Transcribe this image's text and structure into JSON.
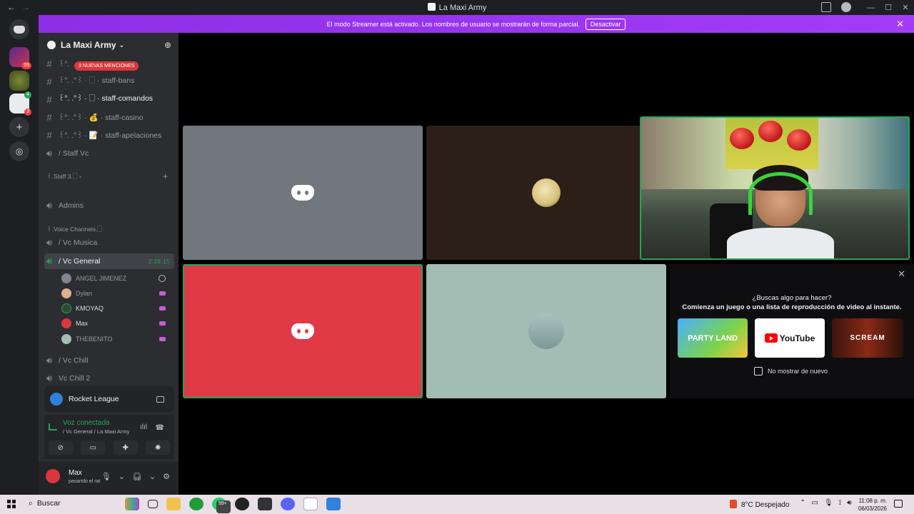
{
  "window": {
    "title": "La Maxi Army"
  },
  "streamer_banner": {
    "text": "El modo Streamer está activado. Los nombres de usuario se mostrarán de forma parcial.",
    "button": "Desactivar"
  },
  "guilds": {
    "badge_55": "55",
    "badge_3": "3",
    "badge_4": "4"
  },
  "server": {
    "name": "La Maxi Army"
  },
  "mentions_badge": "3 NUEVAS MENCIONES",
  "channels": {
    "staff_bans": "꒰ᐢ. .ᐢ꒱ · 🗌 · staff-bans",
    "staff_comandos": "꒰ᐢ. .ᐢ꒱ · 🗌 · staff-comandos",
    "staff_casino": "꒰ᐢ. .ᐢ꒱ · 💰 · staff-casino",
    "staff_apelaciones": "꒰ᐢ. .ᐢ꒱ · 📝 · staff-apelaciones",
    "staff_vc": "/ Staff Vc",
    "cat_staff3": "꒰.Staff 3.🗌 ›",
    "admins": "Admins",
    "cat_voice": "꒰.Voice Channels.🗌",
    "vc_musica": "/ Vc Musica",
    "vc_general": "/ Vc General",
    "vc_general_time": "2:28:15",
    "vc_chill": "/ Vc Chill",
    "vc_chill2": "Vc Chill 2"
  },
  "voice_users": [
    "ANGEL JIMENEZ",
    "Dylan",
    "KMOYAQ",
    "Max",
    "THEBENITO"
  ],
  "activity": {
    "game": "Rocket League"
  },
  "voice_status": {
    "connected": "Voz conectada",
    "location": "/ Vc General / La Maxi Army"
  },
  "user": {
    "name": "Max",
    "status": "pasando el rat"
  },
  "promo": {
    "question": "¿Buscas algo para hacer?",
    "subtitle": "Comienza un juego o una lista de reproducción de video al instante.",
    "card1": "PARTY LAND",
    "card2": "YouTube",
    "card3": "SCREAM",
    "checkbox_label": "No mostrar de nuevo"
  },
  "taskbar": {
    "search": "Buscar",
    "temperature": "8°C",
    "weather": "Despejado",
    "time": "11:08 p. m.",
    "date": "06/03/2026",
    "badge_99": "99+"
  },
  "colors": {
    "banner": "#9b30ff",
    "tile_gray": "#72767d",
    "tile_brown": "#2b1f17",
    "tile_red": "#e03a47",
    "tile_sage": "#a3bcb4",
    "voice_green": "#23a55a"
  }
}
